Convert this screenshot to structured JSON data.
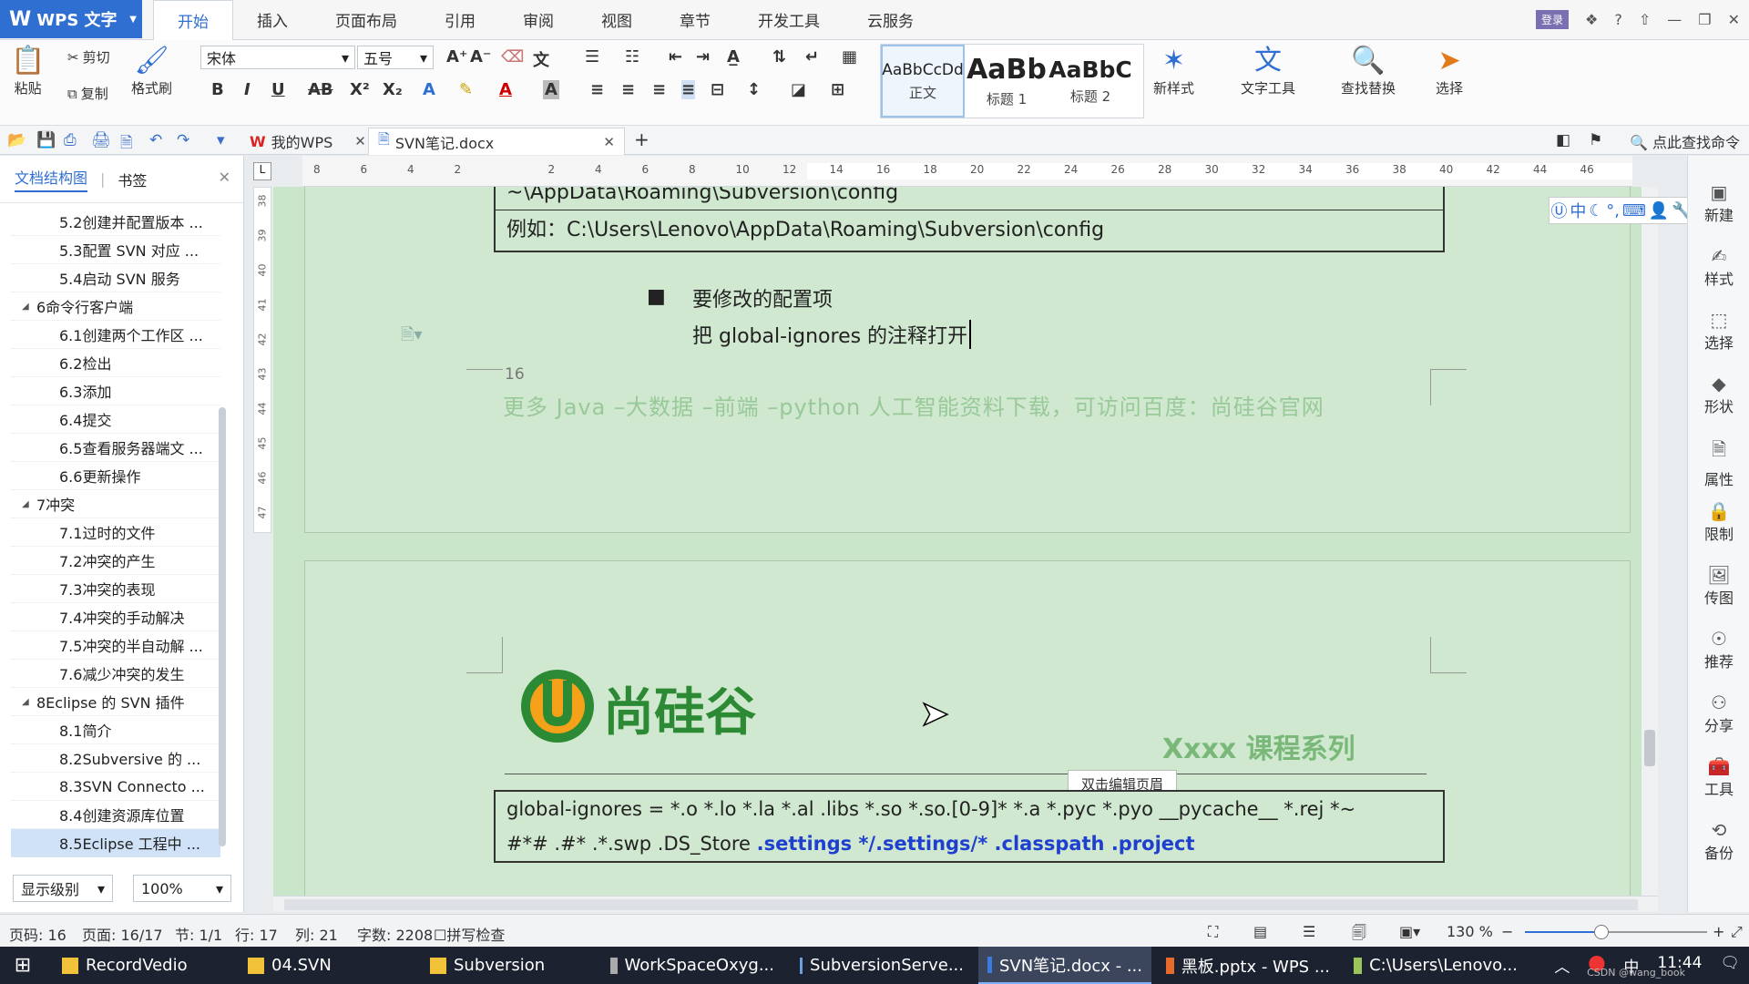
{
  "app": {
    "name": "WPS 文字"
  },
  "menu_tabs": [
    "开始",
    "插入",
    "页面布局",
    "引用",
    "审阅",
    "视图",
    "章节",
    "开发工具",
    "云服务"
  ],
  "title_right": {
    "user": "登录",
    "help": "?"
  },
  "ribbon": {
    "paste": "粘贴",
    "cut": "剪切",
    "copy": "复制",
    "format_painter": "格式刷",
    "font_name": "宋体",
    "font_size": "五号",
    "styles": [
      {
        "preview": "AaBbCcDd",
        "label": "正文"
      },
      {
        "preview": "AaBb",
        "label": "标题 1"
      },
      {
        "preview": "AaBbC",
        "label": "标题 2"
      }
    ],
    "new_style": "新样式",
    "text_tools": "文字工具",
    "find_replace": "查找替换",
    "select": "选择"
  },
  "doc_tabs": [
    {
      "label": "我的WPS"
    },
    {
      "label": "SVN笔记.docx"
    }
  ],
  "search_command": "点此查找命令",
  "nav": {
    "tab_structure": "文档结构图",
    "tab_bookmark": "书签",
    "items": [
      {
        "level": 2,
        "label": "5.2创建并配置版本 ..."
      },
      {
        "level": 2,
        "label": "5.3配置 SVN 对应 ..."
      },
      {
        "level": 2,
        "label": "5.4启动 SVN 服务"
      },
      {
        "level": 1,
        "label": "6命令行客户端"
      },
      {
        "level": 2,
        "label": "6.1创建两个工作区 ..."
      },
      {
        "level": 2,
        "label": "6.2检出"
      },
      {
        "level": 2,
        "label": "6.3添加"
      },
      {
        "level": 2,
        "label": "6.4提交"
      },
      {
        "level": 2,
        "label": "6.5查看服务器端文 ..."
      },
      {
        "level": 2,
        "label": "6.6更新操作"
      },
      {
        "level": 1,
        "label": "7冲突"
      },
      {
        "level": 2,
        "label": "7.1过时的文件"
      },
      {
        "level": 2,
        "label": "7.2冲突的产生"
      },
      {
        "level": 2,
        "label": "7.3冲突的表现"
      },
      {
        "level": 2,
        "label": "7.4冲突的手动解决"
      },
      {
        "level": 2,
        "label": "7.5冲突的半自动解 ..."
      },
      {
        "level": 2,
        "label": "7.6减少冲突的发生"
      },
      {
        "level": 1,
        "label": "8Eclipse 的 SVN 插件"
      },
      {
        "level": 2,
        "label": "8.1简介"
      },
      {
        "level": 2,
        "label": "8.2Subversive 的 ..."
      },
      {
        "level": 2,
        "label": "8.3SVN Connecto ..."
      },
      {
        "level": 2,
        "label": "8.4创建资源库位置"
      },
      {
        "level": 2,
        "label": "8.5Eclipse 工程中 ..."
      }
    ],
    "show_level": "显示级别",
    "zoom": "100%"
  },
  "ruler": {
    "h_ticks": [
      "8",
      "6",
      "4",
      "2",
      "",
      "2",
      "4",
      "6",
      "8",
      "10",
      "12",
      "14",
      "16",
      "18",
      "20",
      "22",
      "24",
      "26",
      "28",
      "30",
      "32",
      "34",
      "36",
      "38",
      "40",
      "42",
      "44",
      "46"
    ],
    "v_ticks": [
      "38",
      "39",
      "40",
      "41",
      "42",
      "43",
      "44",
      "45",
      "46",
      "47"
    ]
  },
  "document": {
    "config_path_line1": "~\\AppData\\Roaming\\Subversion\\config",
    "config_path_line2": "例如：C:\\Users\\Lenovo\\AppData\\Roaming\\Subversion\\config",
    "bullet_title": "要修改的配置项",
    "bullet_text": "把 global-ignores 的注释打开",
    "page_number": "16",
    "footer_watermark": "更多 Java –大数据 –前端 –python 人工智能资料下载，可访问百度：尚硅谷官网",
    "logo_text": "尚硅谷",
    "series_text": "Xxxx 课程系列",
    "header_tooltip": "双击编辑页眉",
    "ignores_line1": "global-ignores = *.o *.lo *.la *.al .libs *.so *.so.[0-9]* *.a *.pyc *.pyo __pycache__ *.rej *~",
    "ignores_line2_plain": "#*# .#* .*.swp .DS_Store ",
    "ignores_line2_bold": ".settings */.settings/* .classpath .project"
  },
  "right_panel": [
    "新建",
    "样式",
    "选择",
    "形状",
    "属性",
    "限制",
    "传图",
    "推荐",
    "分享",
    "工具",
    "备份"
  ],
  "status": {
    "page_code": "页码: 16",
    "page": "页面: 16/17",
    "section": "节: 1/1",
    "row": "行: 17",
    "col": "列: 21",
    "word_count": "字数: 2208",
    "spell_check": "拼写检查",
    "zoom": "130 %",
    "zoom_fraction": 0.42
  },
  "taskbar": {
    "items": [
      "RecordVedio",
      "04.SVN",
      "Subversion",
      "WorkSpaceOxyg...",
      "SubversionServe...",
      "SVN笔记.docx - ...",
      "黑板.pptx - WPS ...",
      "C:\\Users\\Lenovo..."
    ],
    "ime": "中",
    "clock": "11:44",
    "watermark_corner": "CSDN @wang_book"
  },
  "colors": {
    "accent": "#2f6fd2",
    "doc_bg": "#cfe8cf",
    "logo_green": "#2d8a34"
  }
}
